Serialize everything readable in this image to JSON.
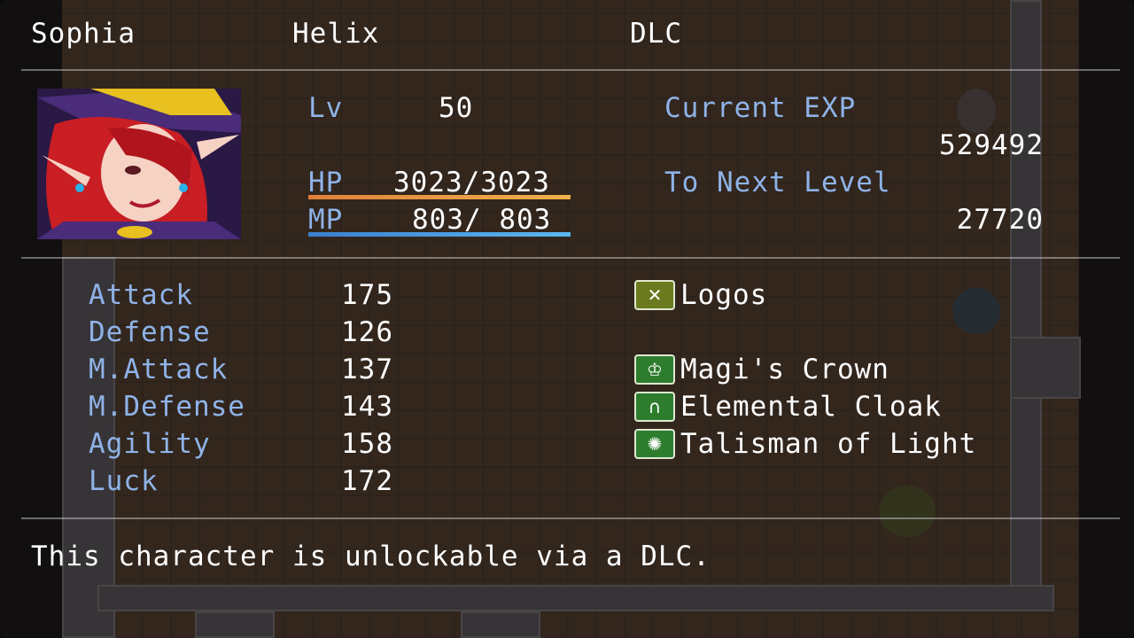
{
  "header": {
    "name": "Sophia",
    "class": "Helix",
    "nickname": "DLC"
  },
  "status": {
    "level_label": "Lv",
    "level": "50",
    "hp_label": "HP",
    "hp_value": "3023/3023",
    "hp_fraction": 1.0,
    "mp_label": "MP",
    "mp_value": "803/ 803",
    "mp_fraction": 1.0,
    "exp_label": "Current EXP",
    "exp_value": "529492",
    "next_label": "To Next Level",
    "next_value": "27720"
  },
  "params": [
    {
      "label": "Attack",
      "value": "175"
    },
    {
      "label": "Defense",
      "value": "126"
    },
    {
      "label": "M.Attack",
      "value": "137"
    },
    {
      "label": "M.Defense",
      "value": "143"
    },
    {
      "label": "Agility",
      "value": "158"
    },
    {
      "label": "Luck",
      "value": "172"
    }
  ],
  "equipment": [
    {
      "name": "Logos",
      "icon": "crossbow-icon",
      "icon_color": "#6b7a1e"
    },
    {
      "name": "",
      "icon": "",
      "icon_color": ""
    },
    {
      "name": "Magi's Crown",
      "icon": "crown-icon",
      "icon_color": "#2e7d2e"
    },
    {
      "name": "Elemental Cloak",
      "icon": "cloak-icon",
      "icon_color": "#2e7d2e"
    },
    {
      "name": "Talisman of Light",
      "icon": "talisman-icon",
      "icon_color": "#2e7d2e"
    }
  ],
  "profile": "This character is unlockable via a DLC.",
  "colors": {
    "system_text": "#8fb3e8",
    "hp_gauge_start": "#e0803a",
    "hp_gauge_end": "#f0b04a",
    "mp_gauge_start": "#3a7fd0",
    "mp_gauge_end": "#5ab8f0"
  }
}
